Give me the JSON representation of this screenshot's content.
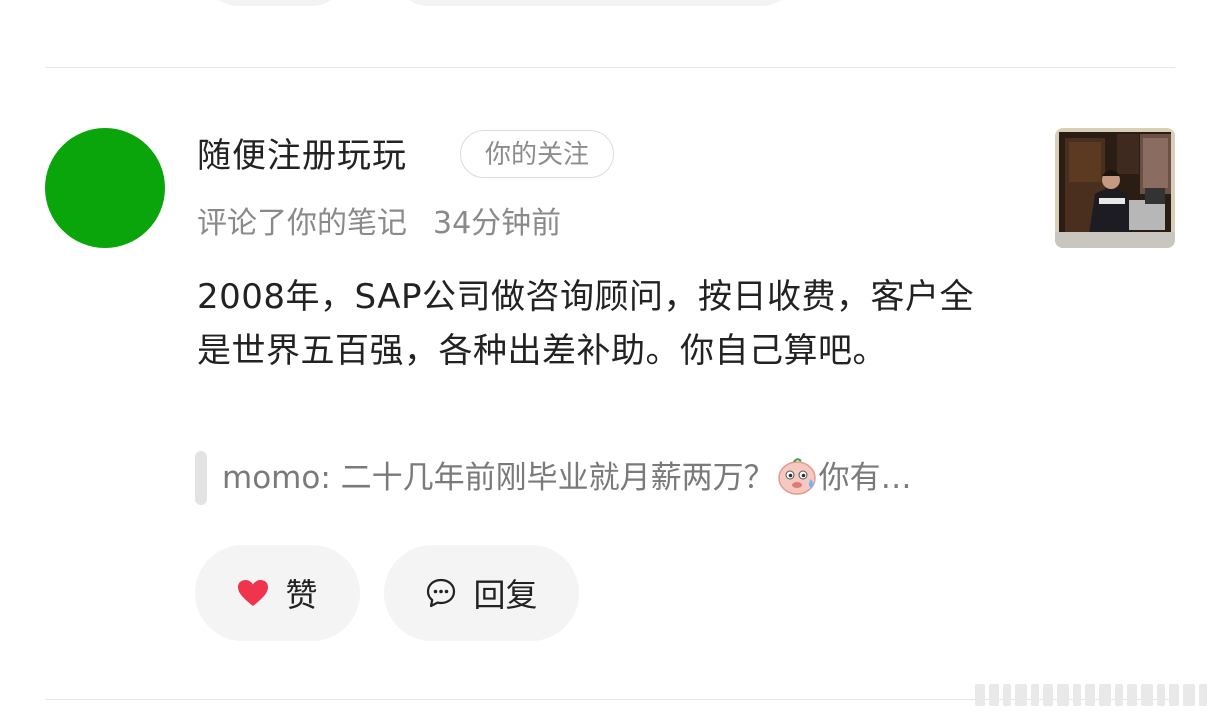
{
  "comment": {
    "username": "随便注册玩玩",
    "follow_badge": "你的关注",
    "action": "评论了你的笔记",
    "time": "34分钟前",
    "text": "2008年，SAP公司做咨询顾问，按日收费，客户全是世界五百强，各种出差补助。你自己算吧。",
    "quote_prefix": "momo: 二十几年前刚毕业就月薪两万？",
    "quote_suffix": "你有…",
    "avatar_color": "#09a50a"
  },
  "actions": {
    "like_label": "赞",
    "reply_label": "回复"
  },
  "colors": {
    "like_heart": "#f0344e",
    "button_bg": "#f4f4f4"
  },
  "icons": {
    "like": "heart-icon",
    "reply": "chat-bubble-icon",
    "quote_emoji": "sweat-face-emoji"
  }
}
